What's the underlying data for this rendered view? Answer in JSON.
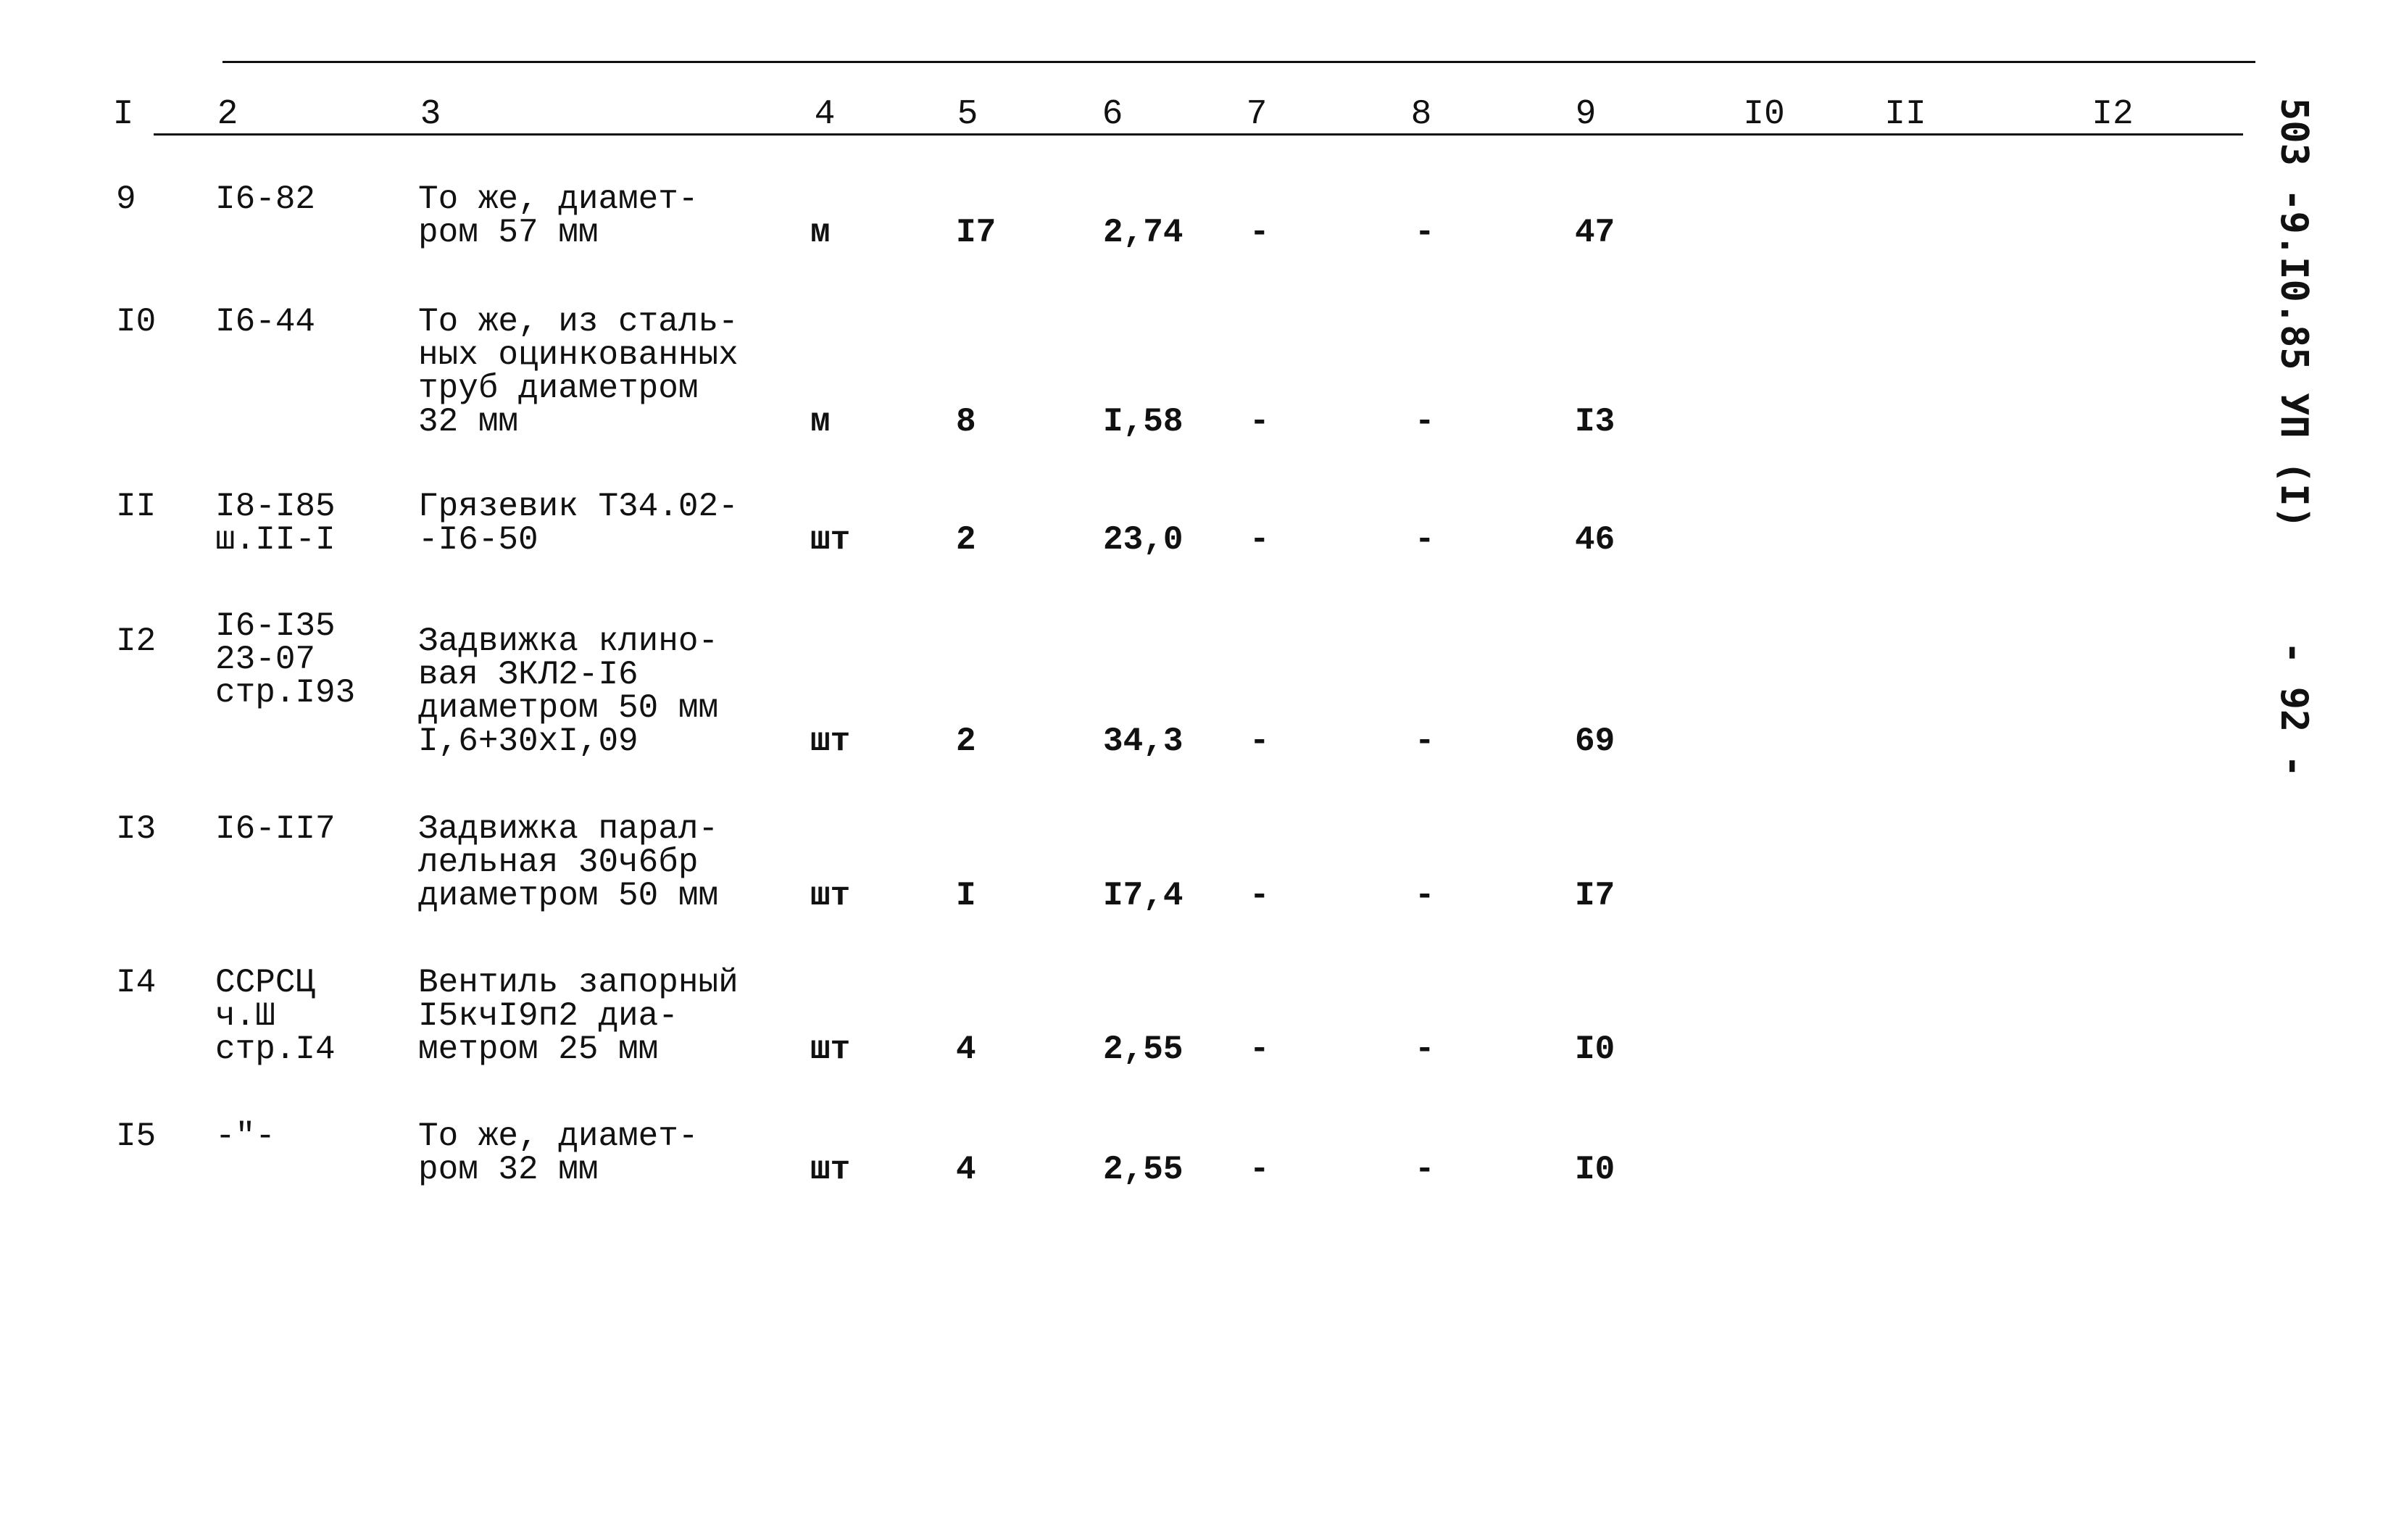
{
  "headers": [
    "I",
    "2",
    "3",
    "4",
    "5",
    "6",
    "7",
    "8",
    "9",
    "I0",
    "II",
    "I2"
  ],
  "rows": [
    {
      "no": "9",
      "code": "I6-82",
      "desc": "То же, диамет-\nром 57 мм",
      "unit": "м",
      "qty": "I7",
      "price": "2,74",
      "c7": "-",
      "c8": "-",
      "c9": "47"
    },
    {
      "no": "I0",
      "code": "I6-44",
      "desc": "То же, из сталь-\nных оцинкованных\nтруб диаметром\n32 мм",
      "unit": "м",
      "qty": "8",
      "price": "I,58",
      "c7": "-",
      "c8": "-",
      "c9": "I3"
    },
    {
      "no": "II",
      "code": "I8-I85\nш.II-I",
      "desc": "Грязевик Т34.02-\n-I6-50",
      "unit": "шт",
      "qty": "2",
      "price": "23,0",
      "c7": "-",
      "c8": "-",
      "c9": "46"
    },
    {
      "no": "I2",
      "code": "I6-I35\n23-07\nстр.I93",
      "desc": "Задвижка клино-\nвая ЗКЛ2-I6\nдиаметром 50 мм\nI,6+30хI,09",
      "unit": "шт",
      "qty": "2",
      "price": "34,3",
      "c7": "-",
      "c8": "-",
      "c9": "69"
    },
    {
      "no": "I3",
      "code": "I6-II7",
      "desc": "Задвижка парал-\nлельная 30ч6бр\nдиаметром 50 мм",
      "unit": "шт",
      "qty": "I",
      "price": "I7,4",
      "c7": "-",
      "c8": "-",
      "c9": "I7"
    },
    {
      "no": "I4",
      "code": "ССРСЦ\nч.Ш\nстр.I4",
      "desc": "Вентиль запорный\nI5кчI9п2 диа-\nметром 25 мм",
      "unit": "шт",
      "qty": "4",
      "price": "2,55",
      "c7": "-",
      "c8": "-",
      "c9": "I0"
    },
    {
      "no": "I5",
      "code": "-\"-",
      "desc": "То же, диамет-\nром 32 мм",
      "unit": "шт",
      "qty": "4",
      "price": "2,55",
      "c7": "-",
      "c8": "-",
      "c9": "I0"
    }
  ],
  "side": {
    "doc_code": "503 -9.I0.85 УП (I)",
    "page": "- 92 -"
  }
}
